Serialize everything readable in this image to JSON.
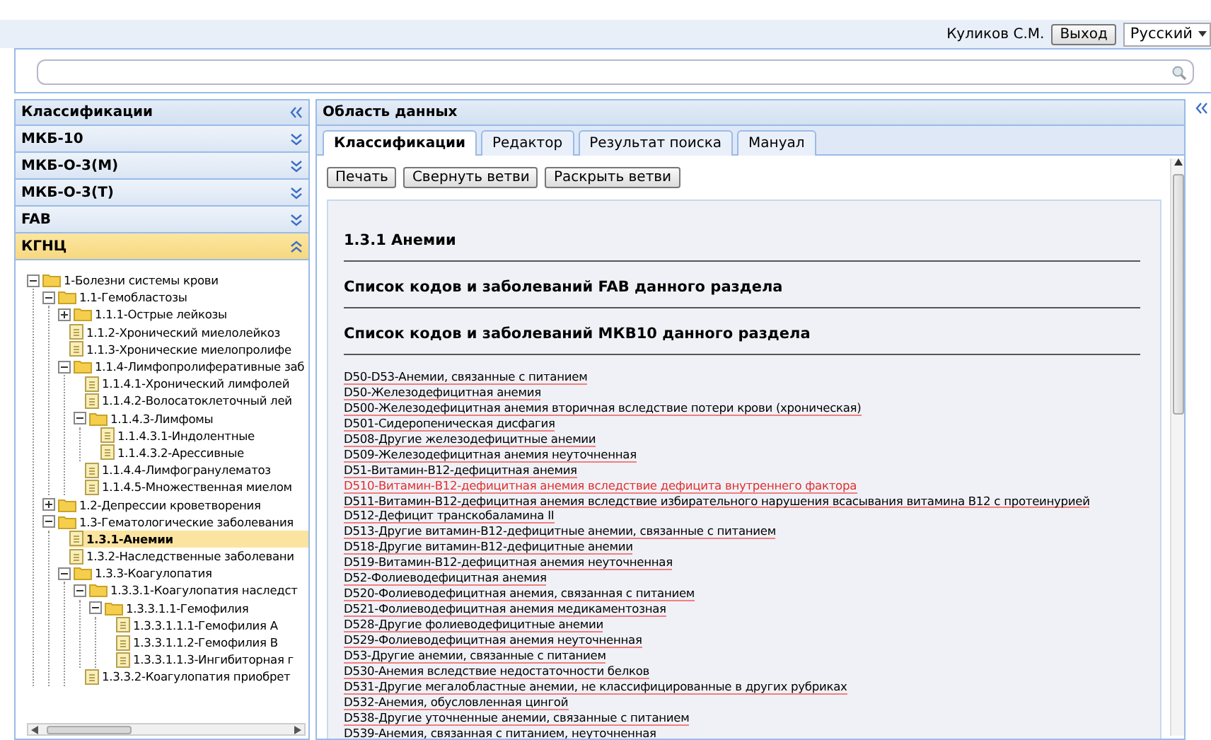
{
  "topbar": {
    "user": "Куликов С.М.",
    "logout": "Выход",
    "language": "Русский"
  },
  "sidebar": {
    "title": "Классификации",
    "sections": [
      {
        "label": "МКБ-10",
        "expanded": false
      },
      {
        "label": "МКБ-О-3(М)",
        "expanded": false
      },
      {
        "label": "МКБ-О-3(Т)",
        "expanded": false
      },
      {
        "label": "FAB",
        "expanded": false
      },
      {
        "label": "КГНЦ",
        "expanded": true
      }
    ],
    "tree": [
      {
        "label": "1-Болезни системы крови",
        "kind": "folder",
        "expanded": true,
        "selected": false,
        "children": [
          {
            "label": "1.1-Гемобластозы",
            "kind": "folder",
            "expanded": true,
            "selected": false,
            "children": [
              {
                "label": "1.1.1-Острые лейкозы",
                "kind": "folder",
                "expanded": false,
                "selected": false
              },
              {
                "label": "1.1.2-Хронический миелолейкоз",
                "kind": "leaf",
                "selected": false
              },
              {
                "label": "1.1.3-Хронические миелопролифе",
                "kind": "leaf",
                "selected": false
              },
              {
                "label": "1.1.4-Лимфопролиферативные заб",
                "kind": "folder",
                "expanded": true,
                "selected": false,
                "children": [
                  {
                    "label": "1.1.4.1-Хронический лимфолей",
                    "kind": "leaf",
                    "selected": false
                  },
                  {
                    "label": "1.1.4.2-Волосатоклеточный лей",
                    "kind": "leaf",
                    "selected": false
                  },
                  {
                    "label": "1.1.4.3-Лимфомы",
                    "kind": "folder",
                    "expanded": true,
                    "selected": false,
                    "children": [
                      {
                        "label": "1.1.4.3.1-Индолентные",
                        "kind": "leaf",
                        "selected": false
                      },
                      {
                        "label": "1.1.4.3.2-Арессивные",
                        "kind": "leaf",
                        "selected": false
                      }
                    ]
                  },
                  {
                    "label": "1.1.4.4-Лимфогранулематоз",
                    "kind": "leaf",
                    "selected": false
                  },
                  {
                    "label": "1.1.4.5-Множественная миелом",
                    "kind": "leaf",
                    "selected": false
                  }
                ]
              }
            ]
          },
          {
            "label": "1.2-Депрессии кроветворения",
            "kind": "folder",
            "expanded": false,
            "selected": false
          },
          {
            "label": "1.3-Гематологические заболевания",
            "kind": "folder",
            "expanded": true,
            "selected": false,
            "children": [
              {
                "label": "1.3.1-Анемии",
                "kind": "leaf",
                "selected": true
              },
              {
                "label": "1.3.2-Наследственные заболевани",
                "kind": "leaf",
                "selected": false
              },
              {
                "label": "1.3.3-Коагулопатия",
                "kind": "folder",
                "expanded": true,
                "selected": false,
                "children": [
                  {
                    "label": "1.3.3.1-Коагулопатия наследст",
                    "kind": "folder",
                    "expanded": true,
                    "selected": false,
                    "children": [
                      {
                        "label": "1.3.3.1.1-Гемофилия",
                        "kind": "folder",
                        "expanded": true,
                        "selected": false,
                        "children": [
                          {
                            "label": "1.3.3.1.1.1-Гемофилия А",
                            "kind": "leaf",
                            "selected": false
                          },
                          {
                            "label": "1.3.3.1.1.2-Гемофилия В",
                            "kind": "leaf",
                            "selected": false
                          },
                          {
                            "label": "1.3.3.1.1.3-Ингибиторная г",
                            "kind": "leaf",
                            "selected": false
                          }
                        ]
                      }
                    ]
                  },
                  {
                    "label": "1.3.3.2-Коагулопатия приобрет",
                    "kind": "leaf",
                    "selected": false
                  }
                ]
              }
            ]
          }
        ]
      }
    ]
  },
  "main": {
    "title": "Область данных",
    "tabs": [
      {
        "label": "Классификации",
        "selected": true
      },
      {
        "label": "Редактор",
        "selected": false
      },
      {
        "label": "Результат поиска",
        "selected": false
      },
      {
        "label": "Мануал",
        "selected": false
      }
    ],
    "buttons": [
      "Печать",
      "Свернуть ветви",
      "Раскрыть ветви"
    ],
    "heading": "1.3.1 Анемии",
    "sections": [
      "Список кодов и заболеваний FAB данного раздела",
      "Список кодов и заболеваний МКВ10 данного раздела"
    ],
    "codes": [
      {
        "text": "D50-D53-Анемии, связанные с питанием",
        "selected": false
      },
      {
        "text": "D50-Железодефицитная анемия",
        "selected": false
      },
      {
        "text": "D500-Железодефицитная анемия вторичная вследствие потери крови (хроническая)",
        "selected": false
      },
      {
        "text": "D501-Сидеропеническая дисфагия",
        "selected": false
      },
      {
        "text": "D508-Другие железодефицитные анемии",
        "selected": false
      },
      {
        "text": "D509-Железодефицитная анемия неуточненная",
        "selected": false
      },
      {
        "text": "D51-Витамин-B12-дефицитная анемия",
        "selected": false
      },
      {
        "text": "D510-Витамин-B12-дефицитная анемия вследствие дефицита внутреннего фактора",
        "selected": true
      },
      {
        "text": "D511-Витамин-B12-дефицитная анемия вследствие избирательного нарушения всасывания витамина B12 с протеинурией",
        "selected": false
      },
      {
        "text": "D512-Дефицит транскобаламина II",
        "selected": false
      },
      {
        "text": "D513-Другие витамин-B12-дефицитные анемии, связанные с питанием",
        "selected": false
      },
      {
        "text": "D518-Другие витамин-B12-дефицитные анемии",
        "selected": false
      },
      {
        "text": "D519-Витамин-B12-дефицитная анемия неуточненная",
        "selected": false
      },
      {
        "text": "D52-Фолиеводефицитная анемия",
        "selected": false
      },
      {
        "text": "D520-Фолиеводефицитная анемия, связанная с питанием",
        "selected": false
      },
      {
        "text": "D521-Фолиеводефицитная анемия медикаментозная",
        "selected": false
      },
      {
        "text": "D528-Другие фолиеводефицитные анемии",
        "selected": false
      },
      {
        "text": "D529-Фолиеводефицитная анемия неуточненная",
        "selected": false
      },
      {
        "text": "D53-Другие анемии, связанные с питанием",
        "selected": false
      },
      {
        "text": "D530-Анемия вследствие недостаточности белков",
        "selected": false
      },
      {
        "text": "D531-Другие мегалобластные анемии, не классифицированные в других рубриках",
        "selected": false
      },
      {
        "text": "D532-Анемия, обусловленная цингой",
        "selected": false
      },
      {
        "text": "D538-Другие уточненные анемии, связанные с питанием",
        "selected": false
      },
      {
        "text": "D539-Анемия, связанная с питанием, неуточненная",
        "selected": false
      }
    ]
  }
}
